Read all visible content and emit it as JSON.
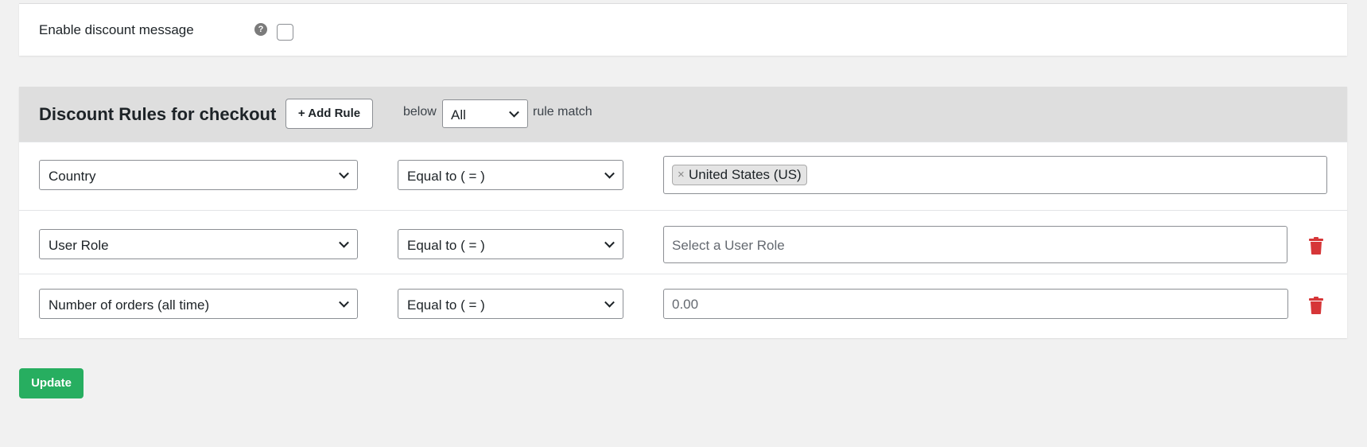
{
  "settings": {
    "enable_discount_label": "Enable discount message",
    "help_icon_glyph": "?"
  },
  "rules": {
    "title": "Discount Rules for checkout",
    "add_rule_label": "+ Add Rule",
    "below_text": "below",
    "match_value": "All",
    "rule_match_text": "rule match",
    "rows": [
      {
        "field": "Country",
        "operator": "Equal to ( = )",
        "tag": "United States (US)",
        "tag_remove": "×"
      },
      {
        "field": "User Role",
        "operator": "Equal to ( = )",
        "placeholder": "Select a User Role"
      },
      {
        "field": "Number of orders (all time)",
        "operator": "Equal to ( = )",
        "placeholder": "0.00"
      }
    ]
  },
  "actions": {
    "update_label": "Update"
  },
  "colors": {
    "update_bg": "#27ae60",
    "trash": "#d63638",
    "header_bg": "#dedede"
  }
}
